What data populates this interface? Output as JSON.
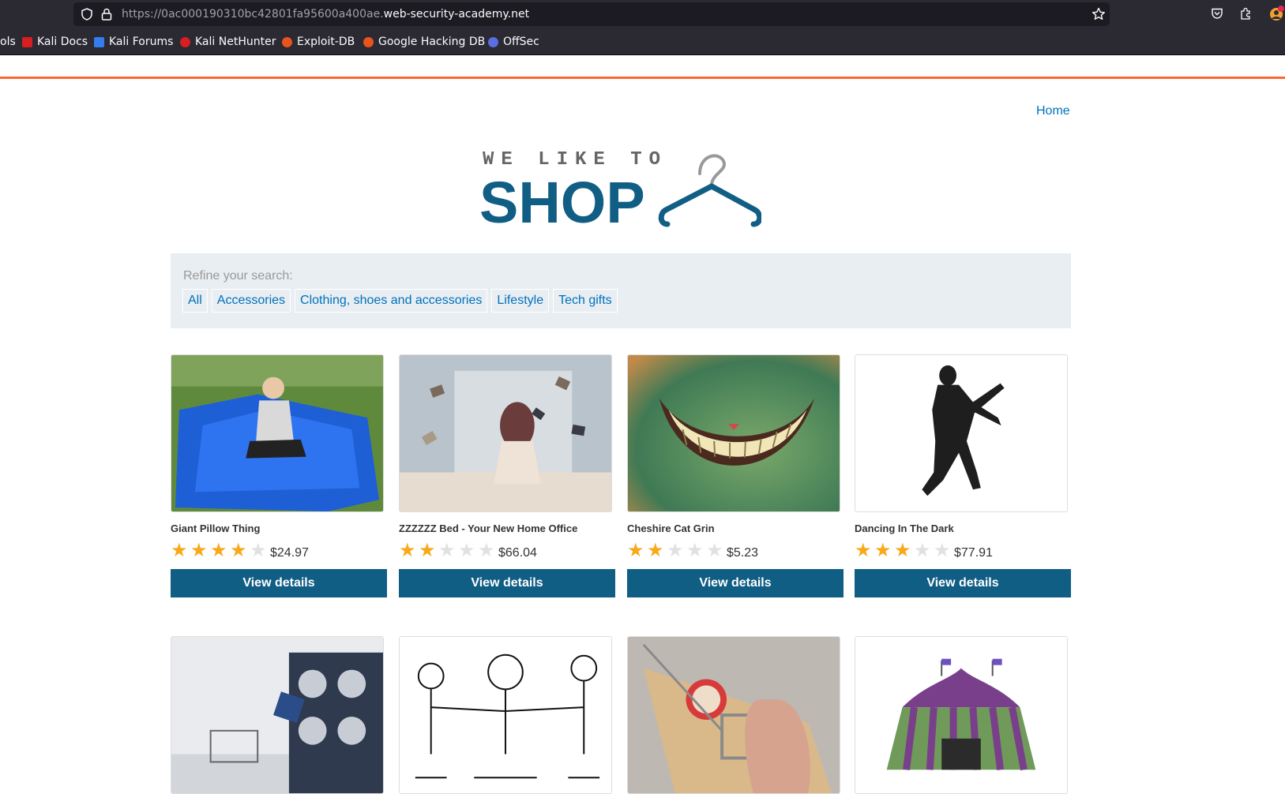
{
  "browser": {
    "url_scheme_id": "https://0ac000190310bc42801fa95600a400ae.",
    "url_domain": "web-security-academy.net",
    "bookmarks": [
      {
        "label": "ols",
        "icon": "kali-tools-icon",
        "color": "#2b2a33"
      },
      {
        "label": "Kali Docs",
        "icon": "kali-docs-icon",
        "color": "#d81e1e"
      },
      {
        "label": "Kali Forums",
        "icon": "kali-forums-icon",
        "color": "#367bf0"
      },
      {
        "label": "Kali NetHunter",
        "icon": "kali-nethunter-icon",
        "color": "#d81e1e"
      },
      {
        "label": "Exploit-DB",
        "icon": "exploit-db-icon",
        "color": "#e8541d"
      },
      {
        "label": "Google Hacking DB",
        "icon": "ghdb-icon",
        "color": "#e8541d"
      },
      {
        "label": "OffSec",
        "icon": "offsec-icon",
        "color": "#5b6ee1"
      }
    ]
  },
  "header": {
    "home_label": "Home",
    "logo_top": "WE LIKE TO",
    "logo_main": "SHOP"
  },
  "filters": {
    "label": "Refine your search:",
    "items": [
      "All",
      "Accessories",
      "Clothing, shoes and accessories",
      "Lifestyle",
      "Tech gifts"
    ]
  },
  "products": [
    {
      "name": "Giant Pillow Thing",
      "rating": 4,
      "price": "$24.97",
      "button": "View details"
    },
    {
      "name": "ZZZZZZ Bed - Your New Home Office",
      "rating": 2,
      "price": "$66.04",
      "button": "View details"
    },
    {
      "name": "Cheshire Cat Grin",
      "rating": 2,
      "price": "$5.23",
      "button": "View details"
    },
    {
      "name": "Dancing In The Dark",
      "rating": 3,
      "price": "$77.91",
      "button": "View details"
    }
  ],
  "colors": {
    "accent": "#ff6633",
    "link": "#0071bc",
    "button": "#115e85",
    "star": "#f8a91a"
  }
}
